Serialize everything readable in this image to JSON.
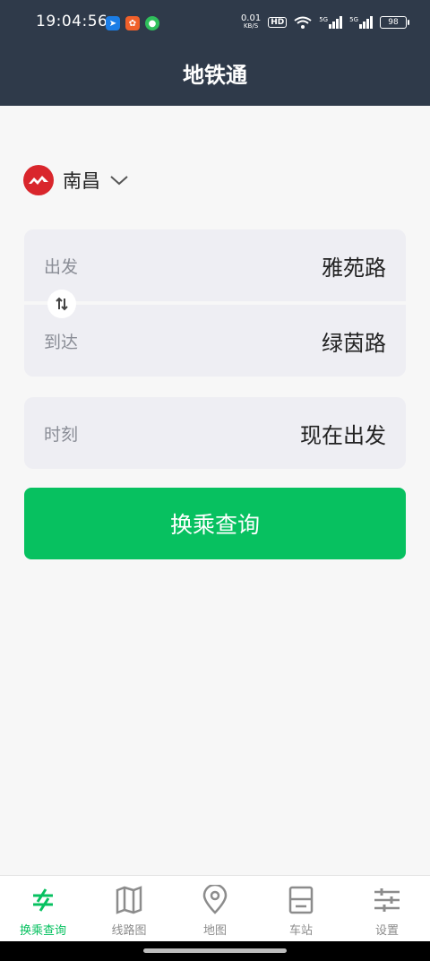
{
  "status_bar": {
    "time": "19:04:56",
    "net_speed_value": "0.01",
    "net_speed_unit": "KB/S",
    "hd_label": "HD",
    "signal_label_1": "5G",
    "signal_label_2": "5G",
    "battery": "98"
  },
  "header": {
    "title": "地铁通"
  },
  "city": {
    "name": "南昌",
    "logo_color": "#d9262c"
  },
  "route": {
    "from_label": "出发",
    "from_value": "雅苑路",
    "to_label": "到达",
    "to_value": "绿茵路"
  },
  "time": {
    "label": "时刻",
    "value": "现在出发"
  },
  "query_button": {
    "label": "换乘查询",
    "color": "#07c160"
  },
  "bottom_nav": {
    "items": [
      {
        "label": "换乘查询",
        "icon": "transfer-icon",
        "active": true
      },
      {
        "label": "线路图",
        "icon": "map-fold-icon",
        "active": false
      },
      {
        "label": "地图",
        "icon": "location-pin-icon",
        "active": false
      },
      {
        "label": "车站",
        "icon": "station-icon",
        "active": false
      },
      {
        "label": "设置",
        "icon": "settings-sliders-icon",
        "active": false
      }
    ]
  },
  "colors": {
    "header_bg": "#2f3a4a",
    "accent": "#07c160",
    "inactive": "#8c8c8c"
  }
}
